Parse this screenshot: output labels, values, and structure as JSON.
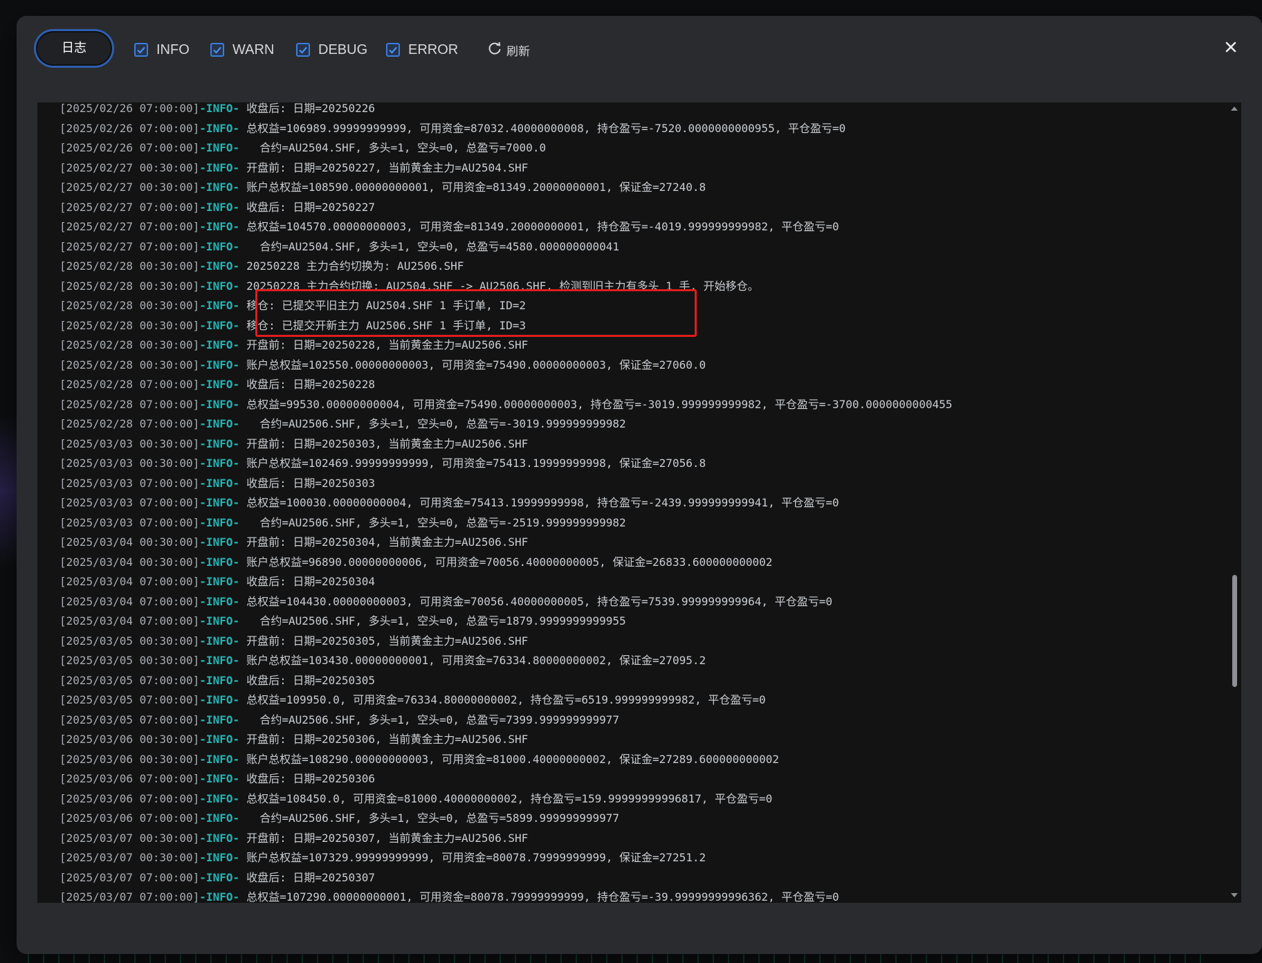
{
  "toolbar": {
    "log_tab_label": "日志",
    "filters": [
      {
        "label": "INFO",
        "checked": true
      },
      {
        "label": "WARN",
        "checked": true
      },
      {
        "label": "DEBUG",
        "checked": true
      },
      {
        "label": "ERROR",
        "checked": true
      }
    ],
    "refresh_label": "刷新",
    "close_icon": "close-icon",
    "refresh_icon": "refresh-icon"
  },
  "colors": {
    "accent": "#3b7de0",
    "level_info": "#27b3b3",
    "highlight": "#e01d1d"
  },
  "log": {
    "lines": [
      {
        "ts": "[2025/02/26 07:00:00]",
        "level": "-INFO-",
        "msg": "收盘后: 日期=20250226"
      },
      {
        "ts": "[2025/02/26 07:00:00]",
        "level": "-INFO-",
        "msg": "总权益=106989.99999999999, 可用资金=87032.40000000008, 持仓盈亏=-7520.0000000000955, 平仓盈亏=0"
      },
      {
        "ts": "[2025/02/26 07:00:00]",
        "level": "-INFO-",
        "msg": "  合约=AU2504.SHF, 多头=1, 空头=0, 总盈亏=7000.0"
      },
      {
        "ts": "[2025/02/27 00:30:00]",
        "level": "-INFO-",
        "msg": "开盘前: 日期=20250227, 当前黄金主力=AU2504.SHF"
      },
      {
        "ts": "[2025/02/27 00:30:00]",
        "level": "-INFO-",
        "msg": "账户总权益=108590.00000000001, 可用资金=81349.20000000001, 保证金=27240.8"
      },
      {
        "ts": "[2025/02/27 07:00:00]",
        "level": "-INFO-",
        "msg": "收盘后: 日期=20250227"
      },
      {
        "ts": "[2025/02/27 07:00:00]",
        "level": "-INFO-",
        "msg": "总权益=104570.00000000003, 可用资金=81349.20000000001, 持仓盈亏=-4019.999999999982, 平仓盈亏=0"
      },
      {
        "ts": "[2025/02/27 07:00:00]",
        "level": "-INFO-",
        "msg": "  合约=AU2504.SHF, 多头=1, 空头=0, 总盈亏=4580.000000000041"
      },
      {
        "ts": "[2025/02/28 00:30:00]",
        "level": "-INFO-",
        "msg": "20250228 主力合约切换为: AU2506.SHF"
      },
      {
        "ts": "[2025/02/28 00:30:00]",
        "level": "-INFO-",
        "msg": "20250228 主力合约切换: AU2504.SHF -> AU2506.SHF, 检测到旧主力有多头 1 手, 开始移仓。"
      },
      {
        "ts": "[2025/02/28 00:30:00]",
        "level": "-INFO-",
        "msg": "移仓: 已提交平旧主力 AU2504.SHF 1 手订单, ID=2"
      },
      {
        "ts": "[2025/02/28 00:30:00]",
        "level": "-INFO-",
        "msg": "移仓: 已提交开新主力 AU2506.SHF 1 手订单, ID=3"
      },
      {
        "ts": "[2025/02/28 00:30:00]",
        "level": "-INFO-",
        "msg": "开盘前: 日期=20250228, 当前黄金主力=AU2506.SHF"
      },
      {
        "ts": "[2025/02/28 00:30:00]",
        "level": "-INFO-",
        "msg": "账户总权益=102550.00000000003, 可用资金=75490.00000000003, 保证金=27060.0"
      },
      {
        "ts": "[2025/02/28 07:00:00]",
        "level": "-INFO-",
        "msg": "收盘后: 日期=20250228"
      },
      {
        "ts": "[2025/02/28 07:00:00]",
        "level": "-INFO-",
        "msg": "总权益=99530.00000000004, 可用资金=75490.00000000003, 持仓盈亏=-3019.999999999982, 平仓盈亏=-3700.0000000000455"
      },
      {
        "ts": "[2025/02/28 07:00:00]",
        "level": "-INFO-",
        "msg": "  合约=AU2506.SHF, 多头=1, 空头=0, 总盈亏=-3019.999999999982"
      },
      {
        "ts": "[2025/03/03 00:30:00]",
        "level": "-INFO-",
        "msg": "开盘前: 日期=20250303, 当前黄金主力=AU2506.SHF"
      },
      {
        "ts": "[2025/03/03 00:30:00]",
        "level": "-INFO-",
        "msg": "账户总权益=102469.99999999999, 可用资金=75413.19999999998, 保证金=27056.8"
      },
      {
        "ts": "[2025/03/03 07:00:00]",
        "level": "-INFO-",
        "msg": "收盘后: 日期=20250303"
      },
      {
        "ts": "[2025/03/03 07:00:00]",
        "level": "-INFO-",
        "msg": "总权益=100030.00000000004, 可用资金=75413.19999999998, 持仓盈亏=-2439.999999999941, 平仓盈亏=0"
      },
      {
        "ts": "[2025/03/03 07:00:00]",
        "level": "-INFO-",
        "msg": "  合约=AU2506.SHF, 多头=1, 空头=0, 总盈亏=-2519.999999999982"
      },
      {
        "ts": "[2025/03/04 00:30:00]",
        "level": "-INFO-",
        "msg": "开盘前: 日期=20250304, 当前黄金主力=AU2506.SHF"
      },
      {
        "ts": "[2025/03/04 00:30:00]",
        "level": "-INFO-",
        "msg": "账户总权益=96890.00000000006, 可用资金=70056.40000000005, 保证金=26833.600000000002"
      },
      {
        "ts": "[2025/03/04 07:00:00]",
        "level": "-INFO-",
        "msg": "收盘后: 日期=20250304"
      },
      {
        "ts": "[2025/03/04 07:00:00]",
        "level": "-INFO-",
        "msg": "总权益=104430.00000000003, 可用资金=70056.40000000005, 持仓盈亏=7539.999999999964, 平仓盈亏=0"
      },
      {
        "ts": "[2025/03/04 07:00:00]",
        "level": "-INFO-",
        "msg": "  合约=AU2506.SHF, 多头=1, 空头=0, 总盈亏=1879.9999999999955"
      },
      {
        "ts": "[2025/03/05 00:30:00]",
        "level": "-INFO-",
        "msg": "开盘前: 日期=20250305, 当前黄金主力=AU2506.SHF"
      },
      {
        "ts": "[2025/03/05 00:30:00]",
        "level": "-INFO-",
        "msg": "账户总权益=103430.00000000001, 可用资金=76334.80000000002, 保证金=27095.2"
      },
      {
        "ts": "[2025/03/05 07:00:00]",
        "level": "-INFO-",
        "msg": "收盘后: 日期=20250305"
      },
      {
        "ts": "[2025/03/05 07:00:00]",
        "level": "-INFO-",
        "msg": "总权益=109950.0, 可用资金=76334.80000000002, 持仓盈亏=6519.999999999982, 平仓盈亏=0"
      },
      {
        "ts": "[2025/03/05 07:00:00]",
        "level": "-INFO-",
        "msg": "  合约=AU2506.SHF, 多头=1, 空头=0, 总盈亏=7399.999999999977"
      },
      {
        "ts": "[2025/03/06 00:30:00]",
        "level": "-INFO-",
        "msg": "开盘前: 日期=20250306, 当前黄金主力=AU2506.SHF"
      },
      {
        "ts": "[2025/03/06 00:30:00]",
        "level": "-INFO-",
        "msg": "账户总权益=108290.00000000003, 可用资金=81000.40000000002, 保证金=27289.600000000002"
      },
      {
        "ts": "[2025/03/06 07:00:00]",
        "level": "-INFO-",
        "msg": "收盘后: 日期=20250306"
      },
      {
        "ts": "[2025/03/06 07:00:00]",
        "level": "-INFO-",
        "msg": "总权益=108450.0, 可用资金=81000.40000000002, 持仓盈亏=159.99999999996817, 平仓盈亏=0"
      },
      {
        "ts": "[2025/03/06 07:00:00]",
        "level": "-INFO-",
        "msg": "  合约=AU2506.SHF, 多头=1, 空头=0, 总盈亏=5899.999999999977"
      },
      {
        "ts": "[2025/03/07 00:30:00]",
        "level": "-INFO-",
        "msg": "开盘前: 日期=20250307, 当前黄金主力=AU2506.SHF"
      },
      {
        "ts": "[2025/03/07 00:30:00]",
        "level": "-INFO-",
        "msg": "账户总权益=107329.99999999999, 可用资金=80078.79999999999, 保证金=27251.2"
      },
      {
        "ts": "[2025/03/07 07:00:00]",
        "level": "-INFO-",
        "msg": "收盘后: 日期=20250307"
      },
      {
        "ts": "[2025/03/07 07:00:00]",
        "level": "-INFO-",
        "msg": "总权益=107290.00000000001, 可用资金=80078.79999999999, 持仓盈亏=-39.99999999996362, 平仓盈亏=0"
      }
    ]
  }
}
